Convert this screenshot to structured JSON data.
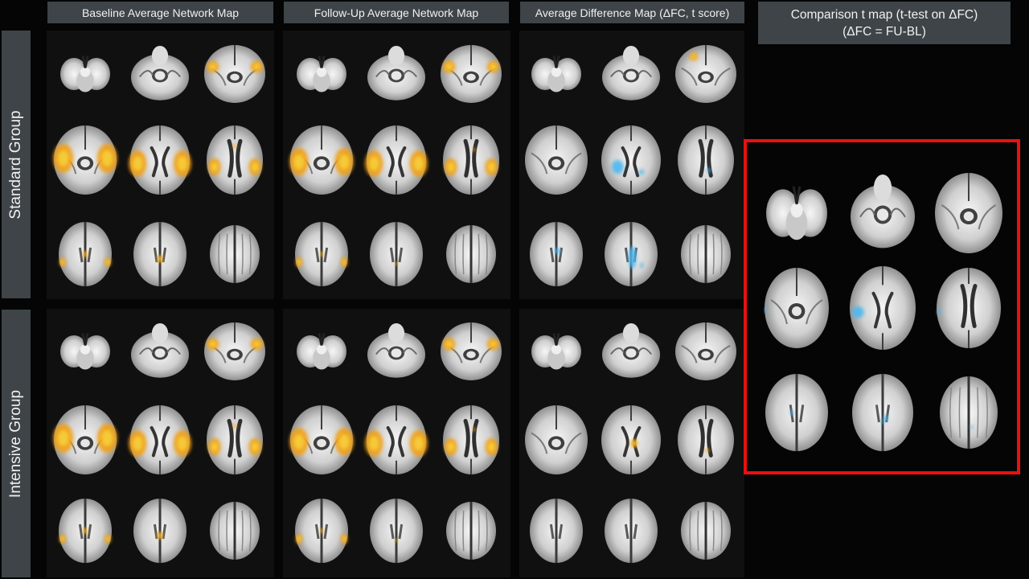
{
  "columns": [
    {
      "title": "Baseline Average Network Map"
    },
    {
      "title": "Follow-Up Average Network Map"
    },
    {
      "title": "Average Difference Map (ΔFC, t score)"
    }
  ],
  "comparison": {
    "title_line1": "Comparison t map (t-test on ΔFC)",
    "title_line2": "(ΔFC = FU-BL)"
  },
  "rows": [
    {
      "label": "Standard Group"
    },
    {
      "label": "Intensive Group"
    }
  ],
  "colors": {
    "background": "#050505",
    "header_bg": "#3e4447",
    "header_text": "#f1f1f1",
    "activation_warm": "#f2a019",
    "activation_cool": "#4db8f0",
    "highlight_border": "#e8110f"
  }
}
